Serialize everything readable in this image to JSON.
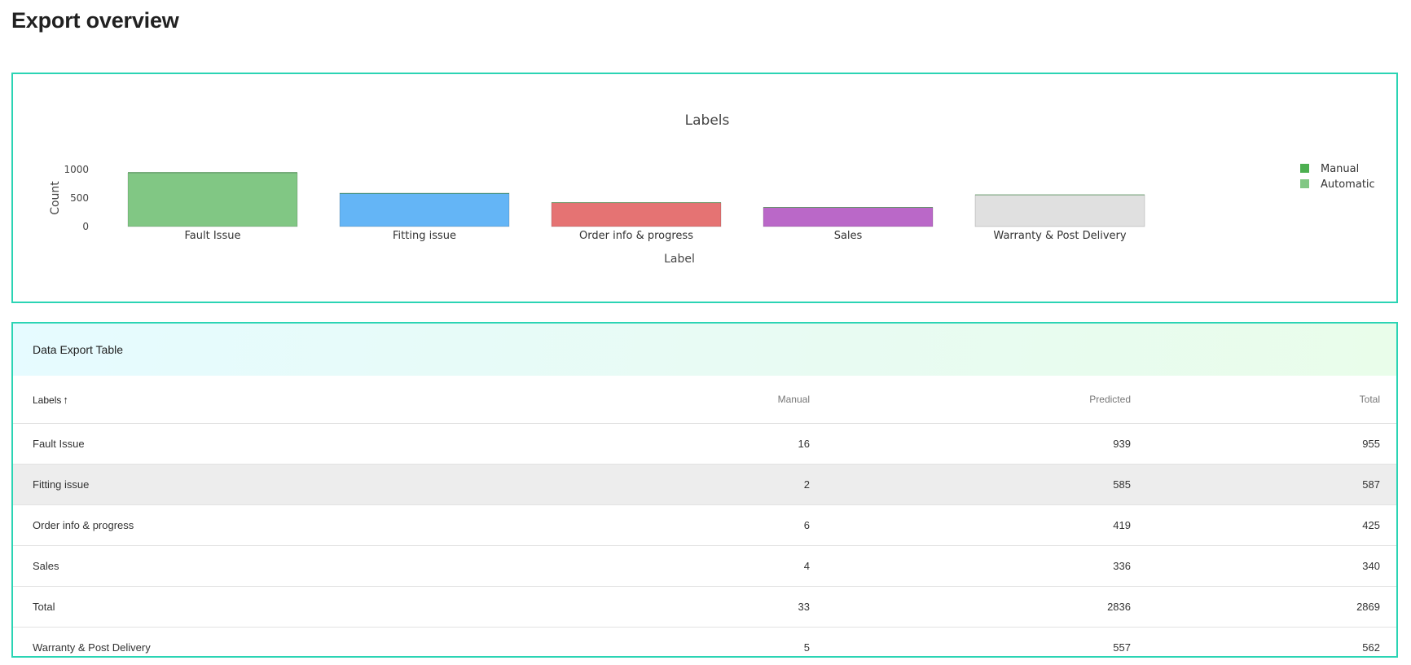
{
  "page": {
    "title": "Export overview"
  },
  "chart_data": {
    "type": "bar",
    "title": "Labels",
    "xlabel": "Label",
    "ylabel": "Count",
    "ylim": [
      0,
      1000
    ],
    "yticks": [
      "0",
      "500",
      "1000"
    ],
    "categories": [
      "Fault Issue",
      "Fitting issue",
      "Order info & progress",
      "Sales",
      "Warranty & Post Delivery"
    ],
    "series": [
      {
        "name": "Manual",
        "values": [
          16,
          2,
          6,
          4,
          5
        ]
      },
      {
        "name": "Automatic",
        "values": [
          939,
          585,
          419,
          336,
          557
        ]
      }
    ],
    "bar_colors": [
      "#81c784",
      "#64b5f6",
      "#e57373",
      "#ba68c8",
      "#e0e0e0"
    ],
    "legend": {
      "position": "right",
      "items": [
        {
          "label": "Manual",
          "color": "#4caf50"
        },
        {
          "label": "Automatic",
          "color": "#81c784"
        }
      ]
    },
    "grid": false
  },
  "table": {
    "title": "Data Export Table",
    "columns": {
      "labels": "Labels",
      "manual": "Manual",
      "predicted": "Predicted",
      "total": "Total"
    },
    "sort_icon": "arrow-up-icon",
    "rows": [
      {
        "label": "Fault Issue",
        "manual": "16",
        "predicted": "939",
        "total": "955"
      },
      {
        "label": "Fitting issue",
        "manual": "2",
        "predicted": "585",
        "total": "587"
      },
      {
        "label": "Order info & progress",
        "manual": "6",
        "predicted": "419",
        "total": "425"
      },
      {
        "label": "Sales",
        "manual": "4",
        "predicted": "336",
        "total": "340"
      },
      {
        "label": "Total",
        "manual": "33",
        "predicted": "2836",
        "total": "2869"
      },
      {
        "label": "Warranty & Post Delivery",
        "manual": "5",
        "predicted": "557",
        "total": "562"
      }
    ]
  }
}
